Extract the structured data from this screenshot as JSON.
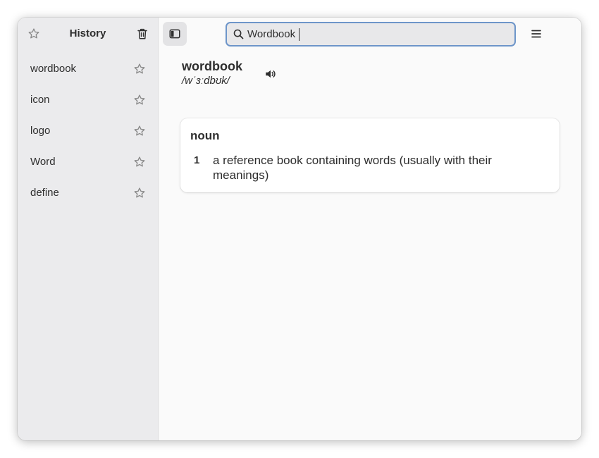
{
  "sidebar": {
    "title": "History",
    "items": [
      {
        "label": "wordbook"
      },
      {
        "label": "icon"
      },
      {
        "label": "logo"
      },
      {
        "label": "Word"
      },
      {
        "label": "define"
      }
    ]
  },
  "search": {
    "value": "Wordbook"
  },
  "entry": {
    "word": "wordbook",
    "pronunciation": "/wˈɜːdbʊk/",
    "senses": [
      {
        "part_of_speech": "noun",
        "definitions": [
          {
            "number": "1",
            "text": "a reference book containing words (usually with their meanings)"
          }
        ]
      }
    ]
  },
  "icons": {
    "favorites": "star-outline-icon",
    "clear_history": "trash-icon",
    "toggle_sidebar": "sidebar-toggle-icon",
    "search": "search-icon",
    "menu": "hamburger-menu-icon",
    "close": "close-icon",
    "pronounce": "speaker-icon",
    "history_item_star": "star-outline-icon"
  },
  "colors": {
    "sidebar_bg": "#ebebed",
    "main_bg": "#fafafa",
    "focus_border": "#6d95c9",
    "text": "#2e2e2e",
    "icon": "#8a8a8a"
  }
}
